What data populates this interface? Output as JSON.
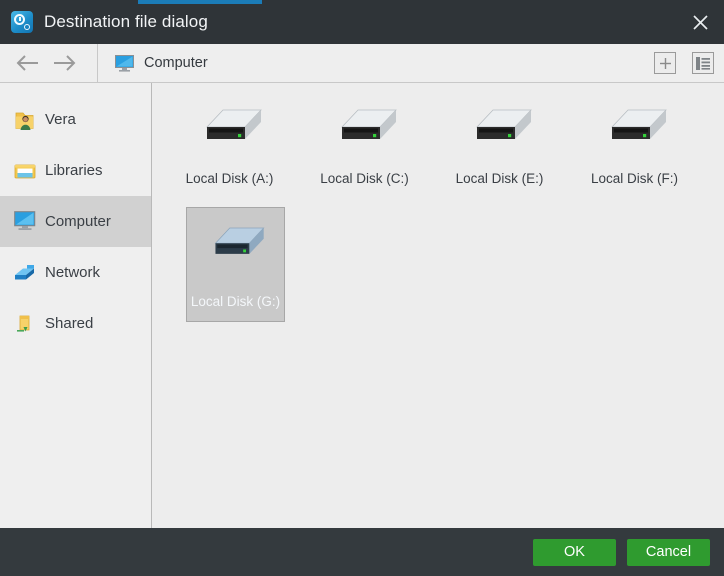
{
  "window": {
    "title": "Destination file dialog",
    "app_icon": "time-machine-icon",
    "close_icon": "close-icon",
    "accent_color": "#1b7cb8",
    "titlebar_color": "#2f3438"
  },
  "toolbar": {
    "back_icon": "arrow-left-icon",
    "forward_icon": "arrow-right-icon",
    "breadcrumb": {
      "icon": "computer-monitor-icon",
      "label": "Computer"
    },
    "new_folder_label": "+",
    "new_folder_icon": "plus-icon",
    "view_mode_icon": "list-view-icon"
  },
  "sidebar": {
    "items": [
      {
        "label": "Vera",
        "icon": "user-folder-icon",
        "selected": false
      },
      {
        "label": "Libraries",
        "icon": "libraries-folder-icon",
        "selected": false
      },
      {
        "label": "Computer",
        "icon": "computer-monitor-icon",
        "selected": true
      },
      {
        "label": "Network",
        "icon": "network-icon",
        "selected": false
      },
      {
        "label": "Shared",
        "icon": "shared-folder-icon",
        "selected": false
      }
    ]
  },
  "files": {
    "items": [
      {
        "label": "Local Disk (A:)",
        "icon": "hard-disk-icon",
        "selected": false
      },
      {
        "label": "Local Disk (C:)",
        "icon": "hard-disk-icon",
        "selected": false
      },
      {
        "label": "Local Disk (E:)",
        "icon": "hard-disk-icon",
        "selected": false
      },
      {
        "label": "Local Disk (F:)",
        "icon": "hard-disk-icon",
        "selected": false
      },
      {
        "label": "Local Disk (G:)",
        "icon": "hard-disk-icon",
        "selected": true
      }
    ]
  },
  "footer": {
    "ok_label": "OK",
    "cancel_label": "Cancel",
    "button_color": "#2f9b2f"
  }
}
